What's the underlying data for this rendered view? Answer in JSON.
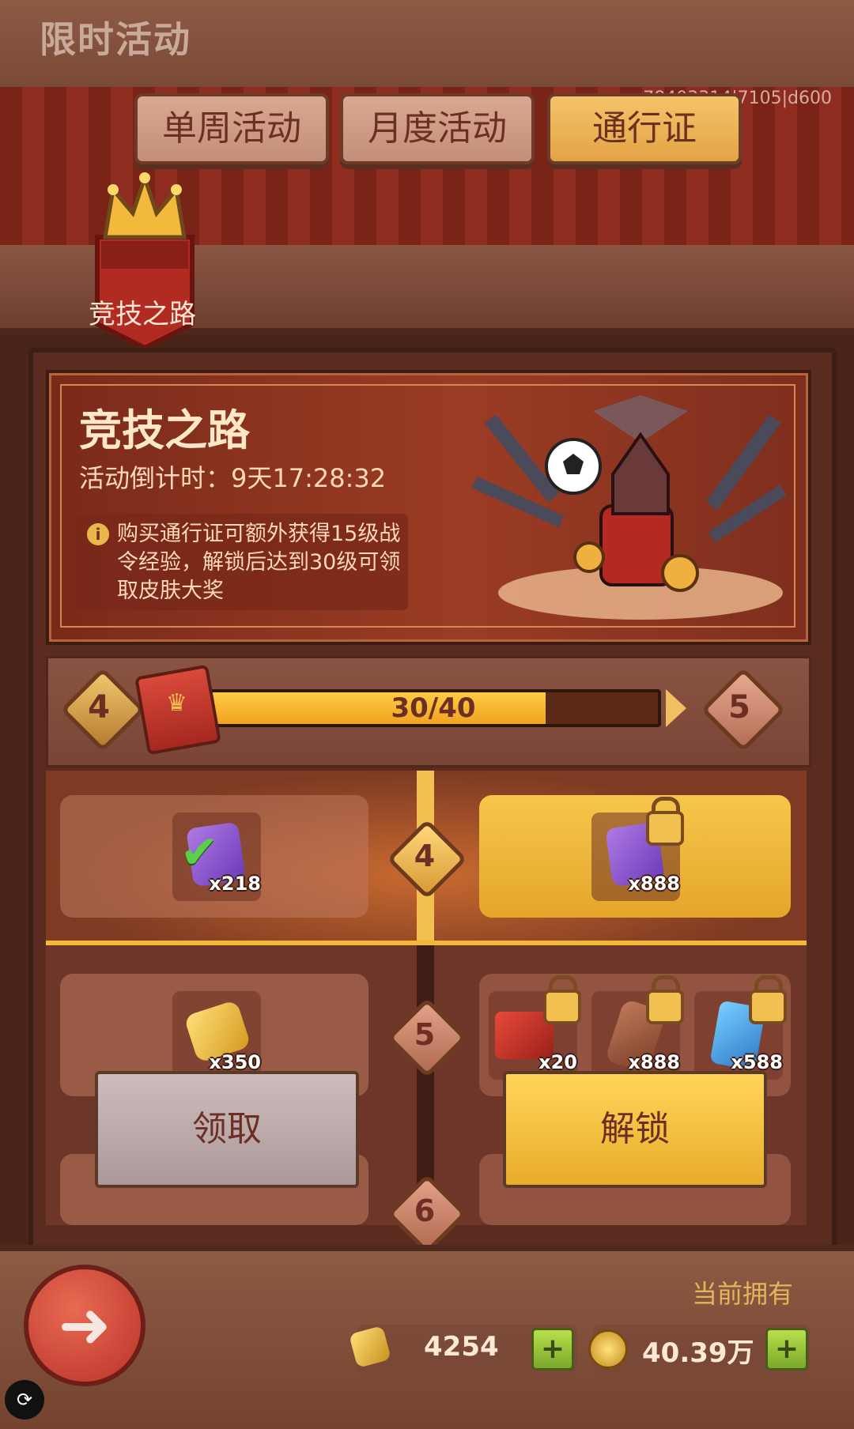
{
  "header": {
    "title": "限时活动"
  },
  "debug_text": "78403314|7105|d600",
  "tabs": [
    {
      "label": "单周活动",
      "active": false
    },
    {
      "label": "月度活动",
      "active": false
    },
    {
      "label": "通行证",
      "active": true
    }
  ],
  "badge": {
    "label": "竞技之路"
  },
  "event": {
    "title": "竞技之路",
    "countdown": "活动倒计时：9天17:28:32",
    "info": "购买通行证可额外获得15级战令经验，解锁后达到30级可领取皮肤大奖"
  },
  "progress": {
    "current_level": "4",
    "next_level": "5",
    "text": "30/40",
    "fraction": 0.75
  },
  "rows": [
    {
      "level": "4",
      "free": {
        "item": "purple-gem-icon",
        "qty": "x218",
        "claimed": true
      },
      "paid": [
        {
          "item": "purple-gem-icon",
          "qty": "x888",
          "locked": true
        }
      ]
    },
    {
      "level": "5",
      "free": {
        "item": "gold-bar-icon",
        "qty": "x350",
        "claimed": false
      },
      "paid": [
        {
          "item": "red-gift-icon",
          "qty": "x20",
          "locked": true
        },
        {
          "item": "brown-stone-icon",
          "qty": "x888",
          "locked": true
        },
        {
          "item": "blue-crystal-icon",
          "qty": "x588",
          "locked": true
        }
      ]
    },
    {
      "level": "6"
    }
  ],
  "buttons": {
    "claim": "领取",
    "unlock": "解锁"
  },
  "footer": {
    "own_label": "当前拥有",
    "gold_value": "4254",
    "coin_value": "40.39万"
  }
}
